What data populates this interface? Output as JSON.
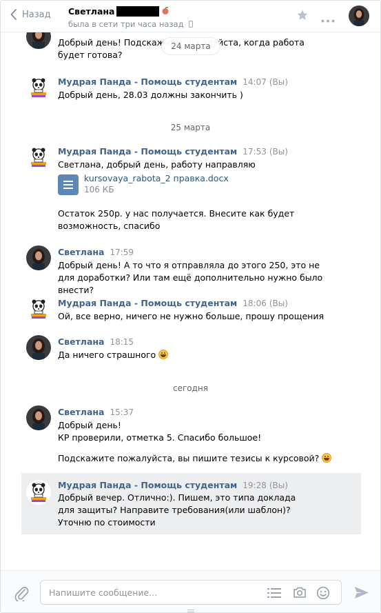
{
  "header": {
    "back_label": "Назад",
    "peer_name": "Светлана",
    "peer_status": "была в сети три часа назад"
  },
  "history": {
    "floating_date": "24 марта",
    "date_separators": [
      "25 марта",
      "сегодня"
    ],
    "first_message_tail": "Добрый день! Подскажите пожалуйста, когда работа будет готова?",
    "messages": [
      {
        "author": "Мудрая Панда - Помощь студентам",
        "time": "14:07",
        "you": "(Вы)",
        "text": "Добрый день, 28.03 должны закончить )"
      },
      {
        "author": "Мудрая Панда - Помощь студентам",
        "time": "17:53",
        "you": "(Вы)",
        "text": "Светлана, добрый день, работу направляю",
        "attachment": {
          "name": "kursovaya_rabota_2 правка.docx",
          "size": "106 КБ"
        },
        "text2": "Остаток 250р. у нас получается. Внесите как будет возможность, спасибо"
      },
      {
        "author": "Светлана",
        "time": "17:59",
        "text": "Добрый день! А то что я отправляла до этого 250, это не для доработки? Или там ещё дополнительно нужно было внести?"
      },
      {
        "author": "Мудрая Панда - Помощь студентам",
        "time": "18:06",
        "you": "(Вы)",
        "text": "Ой, все верно, ничего не нужно больше, прошу прощения"
      },
      {
        "author": "Светлана",
        "time": "18:15",
        "text": "Да ничего страшного"
      },
      {
        "author": "Светлана",
        "time": "15:37",
        "text": "Добрый день!",
        "text_line2": "КР проверили, отметка 5. Спасибо большое!",
        "text2": "Подскажите пожалуйста, вы пишите тезисы к курсовой?"
      },
      {
        "author": "Мудрая Панда - Помощь студентам",
        "time": "19:28",
        "you": "(Вы)",
        "text": "Добрый вечер. Отлично:). Пишем, это типа доклада для защиты? Направите требования(или шаблон)? Уточню по стоимости"
      }
    ]
  },
  "composer": {
    "placeholder": "Напишите сообщение..."
  },
  "colors": {
    "link": "#42648b",
    "highlight_bg": "#edeef0",
    "muted": "#939393"
  }
}
